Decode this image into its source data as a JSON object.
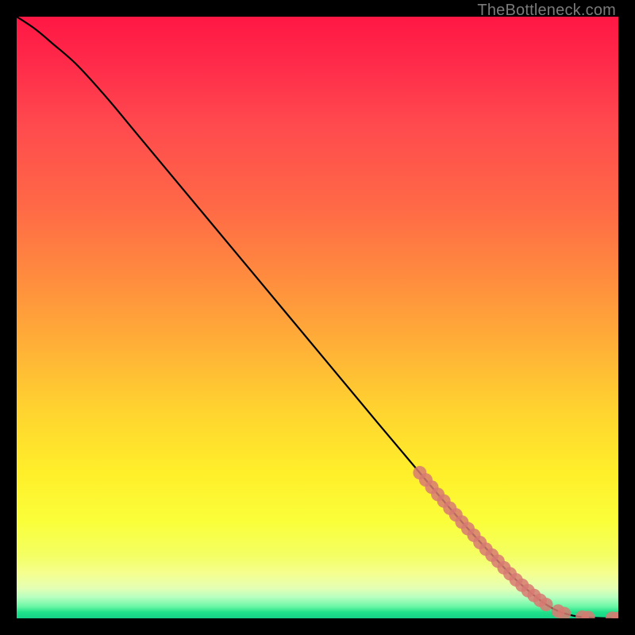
{
  "watermark": "TheBottleneck.com",
  "colors": {
    "page_bg": "#000000",
    "gradient_top": "#ff1744",
    "gradient_bottom": "#15d287",
    "curve": "#000000",
    "marker": "#d77a72"
  },
  "chart_data": {
    "type": "line",
    "title": "",
    "xlabel": "",
    "ylabel": "",
    "xlim": [
      0,
      100
    ],
    "ylim": [
      0,
      100
    ],
    "grid": false,
    "legend": false,
    "series": [
      {
        "name": "curve",
        "x": [
          0,
          3,
          6,
          10,
          15,
          20,
          30,
          40,
          50,
          60,
          68,
          72,
          76,
          80,
          83,
          86,
          88,
          90,
          92,
          94,
          96,
          98,
          100
        ],
        "y": [
          100,
          98,
          95.5,
          92,
          86.5,
          80.5,
          68.5,
          56.5,
          44.5,
          32.5,
          23,
          18.3,
          13.8,
          9.5,
          6.4,
          3.8,
          2.3,
          1.2,
          0.55,
          0.2,
          0.08,
          0.02,
          0
        ]
      }
    ],
    "markers": {
      "name": "points",
      "x": [
        67,
        68,
        69,
        70,
        71,
        72,
        73,
        74,
        75,
        76,
        77,
        78,
        79,
        80,
        81,
        82,
        83,
        84,
        85,
        86,
        87,
        88,
        90,
        91,
        94,
        95,
        99,
        100
      ],
      "y": [
        24.2,
        23.0,
        21.8,
        20.6,
        19.5,
        18.3,
        17.2,
        16.0,
        14.9,
        13.8,
        12.6,
        11.5,
        10.5,
        9.5,
        8.4,
        7.4,
        6.4,
        5.5,
        4.6,
        3.8,
        3.0,
        2.3,
        1.2,
        0.8,
        0.2,
        0.13,
        0.01,
        0.0
      ]
    }
  }
}
